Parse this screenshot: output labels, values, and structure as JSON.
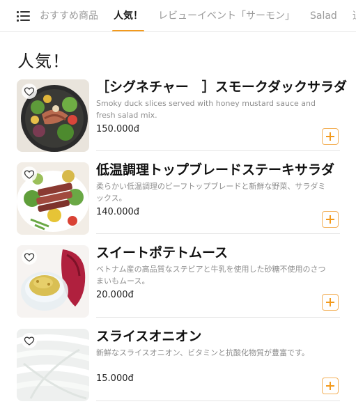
{
  "nav": {
    "tabs": [
      "おすすめ商品",
      "人気！",
      "レビューイベント「サーモン」",
      "Salad",
      "追"
    ],
    "active_tab": "人気！"
  },
  "section": {
    "title": "人気！"
  },
  "items": [
    {
      "name": "［シグネチャー　］スモークダックサラダ",
      "description": "Smoky duck slices served with honey mustard sauce and fresh salad mix.",
      "price": "150.000đ",
      "image": "smoked-duck-salad"
    },
    {
      "name": "低温調理トップブレードステーキサラダ",
      "description": "柔らかい低温調理のビーフトップブレードと新鮮な野菜、サラダミックス。",
      "price": "140.000đ",
      "image": "top-blade-steak-salad"
    },
    {
      "name": "スイートポテトムース",
      "description": "ベトナム産の高品質なステビアと牛乳を使用した砂糖不使用のさつまいもムース。",
      "price": "20.000đ",
      "image": "sweet-potato-mousse"
    },
    {
      "name": "スライスオニオン",
      "description": "新鮮なスライスオニオン、ビタミンと抗酸化物質が豊富です。",
      "price": "15.000đ",
      "image": "sliced-onion"
    }
  ],
  "colors": {
    "accent": "#f39a1c",
    "text": "#1a1a1a",
    "muted": "#8e8e8e",
    "divider": "#e4e4e4"
  }
}
